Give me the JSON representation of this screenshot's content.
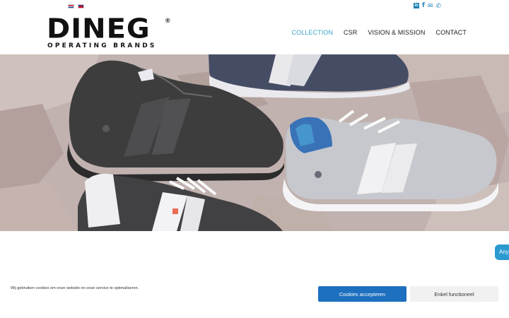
{
  "header": {
    "languages": [
      {
        "code": "nl",
        "icon": "dutch-flag-icon"
      },
      {
        "code": "en",
        "icon": "english-flag-icon"
      }
    ],
    "social_icons": [
      "linkedin-icon",
      "facebook-icon",
      "email-icon",
      "phone-icon"
    ],
    "logo": {
      "main": "DINEG",
      "reg": "®",
      "sub": "OPERATING BRANDS"
    },
    "nav": [
      {
        "label": "COLLECTION",
        "active": true
      },
      {
        "label": "CSR",
        "active": false
      },
      {
        "label": "VISION & MISSION",
        "active": false
      },
      {
        "label": "CONTACT",
        "active": false
      }
    ]
  },
  "side_button": {
    "label": "Any"
  },
  "cookie": {
    "text": "Wij gebruiken cookies om onze website en onze service te optimaliseren.",
    "accept_label": "Cookies accepteren",
    "functional_label": "Enkel functioneel"
  },
  "colors": {
    "accent": "#3aa3c9",
    "button_primary": "#1d6fbf",
    "button_secondary": "#f1f1f1"
  }
}
